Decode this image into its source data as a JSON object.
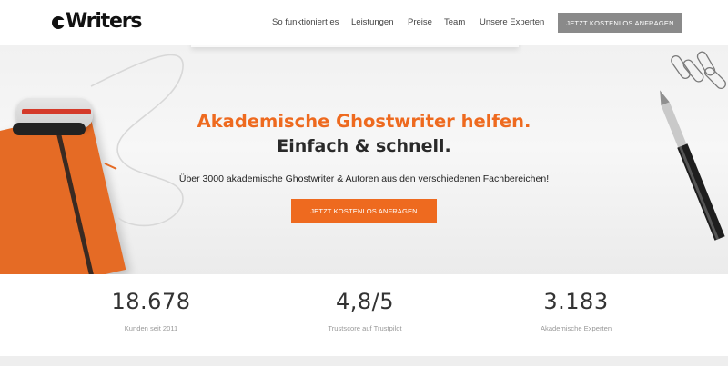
{
  "brand": {
    "logo_text": "Writers"
  },
  "nav": {
    "items": [
      {
        "label": "So funktioniert es"
      },
      {
        "label": "Leistungen"
      },
      {
        "label": "Preise"
      },
      {
        "label": "Team"
      },
      {
        "label": "Unsere Experten"
      }
    ],
    "cta_label": "JETZT KOSTENLOS ANFRAGEN"
  },
  "hero": {
    "title_line1": "Akademische Ghostwriter helfen.",
    "title_line2": "Einfach & schnell.",
    "subtitle": "Über 3000 akademische Ghostwriter & Autoren aus den verschiedenen Fachbereichen!",
    "cta_label": "JETZT KOSTENLOS ANFRAGEN"
  },
  "stats": [
    {
      "value": "18.678",
      "label": "Kunden seit 2011"
    },
    {
      "value": "4,8/5",
      "label": "Trustscore auf Trustpilot"
    },
    {
      "value": "3.183",
      "label": "Akademische Experten"
    }
  ],
  "colors": {
    "accent": "#ee6a1f",
    "header_cta_bg": "#8a8a8a",
    "text_dark": "#2a2a2a"
  }
}
